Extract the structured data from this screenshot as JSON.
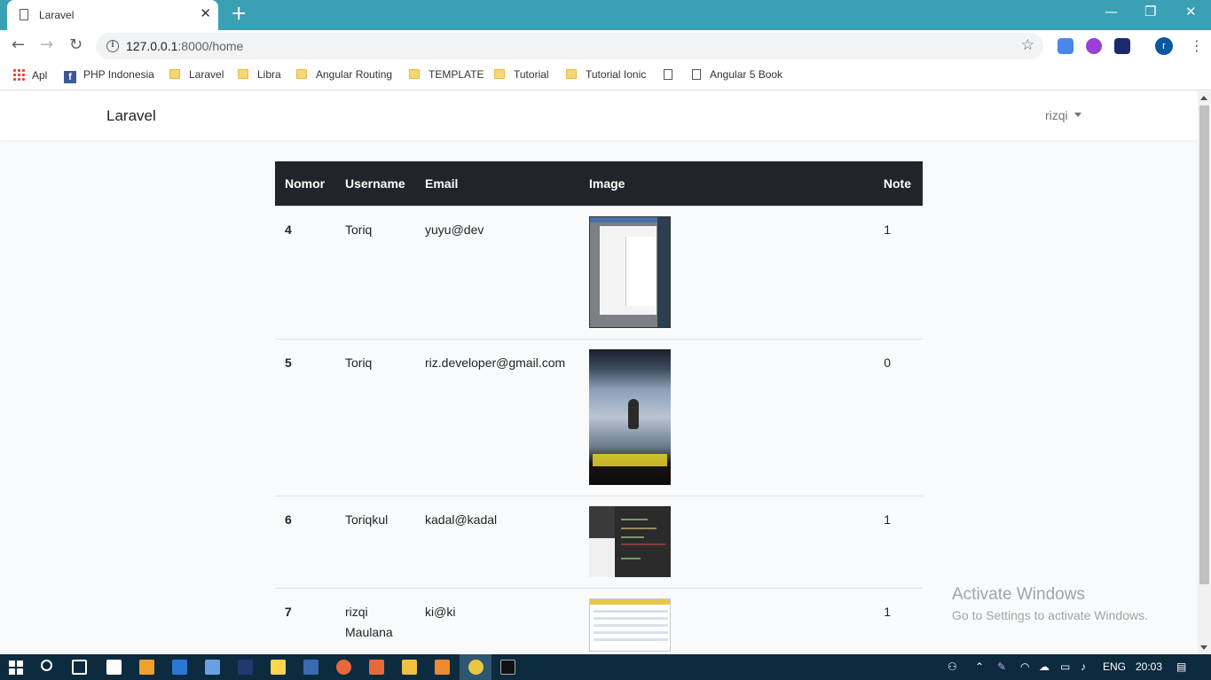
{
  "browser": {
    "tab_title": "Laravel",
    "tab_close": "✕",
    "new_tab": "+",
    "url_host": "127.0.0.1",
    "url_rest": ":8000/home",
    "info_glyph": "i",
    "star_glyph": "☆",
    "back_glyph": "←",
    "forward_glyph": "→",
    "reload_glyph": "↻",
    "minimize_glyph": "—",
    "restore_glyph": "❐",
    "close_glyph": "✕",
    "profile_initial": "r",
    "menu_glyph": "⋮"
  },
  "bookmarks": [
    {
      "label": "Apl",
      "icon": "apps-icon"
    },
    {
      "label": "PHP Indonesia",
      "icon": "facebook-icon"
    },
    {
      "label": "Laravel",
      "icon": "folder-icon"
    },
    {
      "label": "Libra",
      "icon": "folder-icon"
    },
    {
      "label": "Angular Routing",
      "icon": "folder-icon"
    },
    {
      "label": "TEMPLATE",
      "icon": "folder-icon"
    },
    {
      "label": "Tutorial",
      "icon": "folder-icon"
    },
    {
      "label": "Tutorial Ionic",
      "icon": "folder-icon"
    },
    {
      "label": "",
      "icon": "page-icon"
    },
    {
      "label": "Angular 5 Book",
      "icon": "page-icon"
    }
  ],
  "app": {
    "brand": "Laravel",
    "user": "rizqi"
  },
  "table": {
    "headers": [
      "Nomor",
      "Username",
      "Email",
      "Image",
      "Note"
    ],
    "rows": [
      {
        "nomor": "4",
        "username": "Toriq",
        "email": "yuyu@dev",
        "image": "screenshot-thumbnail",
        "note": "1"
      },
      {
        "nomor": "5",
        "username": "Toriq",
        "email": "riz.developer@gmail.com",
        "image": "surfing-thumbnail",
        "note": "0"
      },
      {
        "nomor": "6",
        "username": "Toriqkul",
        "email": "kadal@kadal",
        "image": "code-editor-thumbnail",
        "note": "1"
      },
      {
        "nomor": "7",
        "username": "rizqi Maulana",
        "email": "ki@ki",
        "image": "spreadsheet-thumbnail",
        "note": "1"
      }
    ]
  },
  "watermark": {
    "line1": "Activate Windows",
    "line2": "Go to Settings to activate Windows."
  },
  "taskbar": {
    "language": "ENG",
    "time": "20:03"
  }
}
